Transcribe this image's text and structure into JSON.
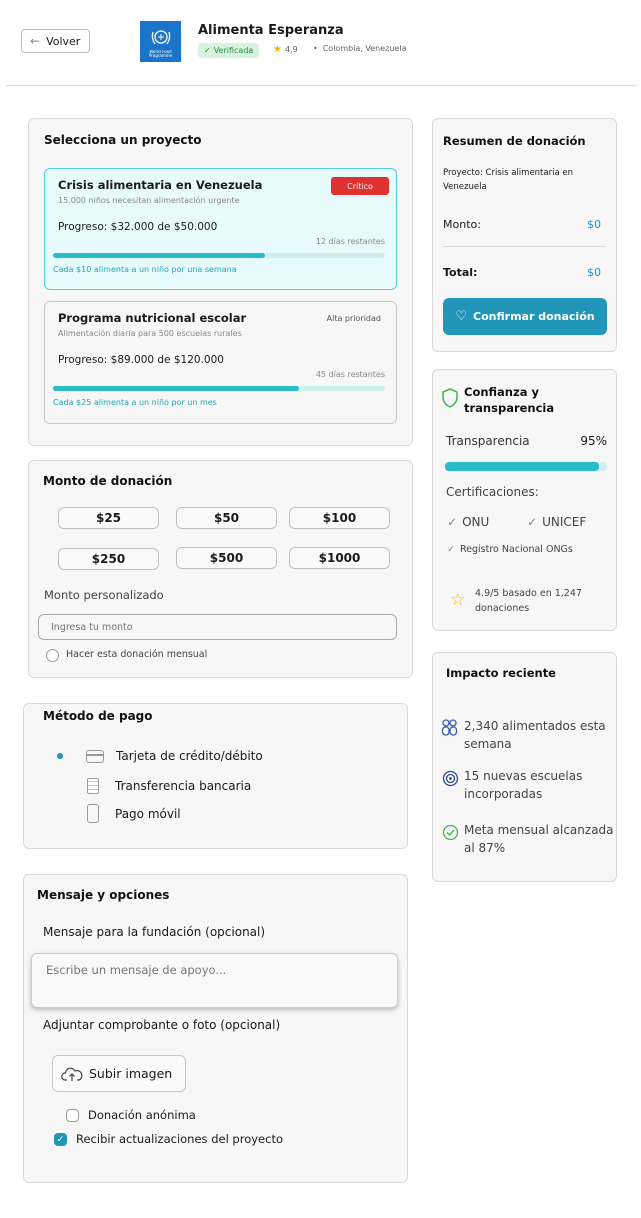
{
  "header": {
    "back_label": "Volver",
    "org_name": "Alimenta Esperanza",
    "verified_label": "Verificada",
    "rating": "4,9",
    "location": "Colombia, Venezuela",
    "logo_text": "World Food Programme"
  },
  "projects": {
    "title": "Selecciona un proyecto",
    "items": [
      {
        "name": "Crisis alimentaria en Venezuela",
        "subtitle": "15.000 niños necesitan alimentación urgente",
        "badge": "Crítico",
        "progress_label": "Progreso: $32.000 de $50.000",
        "progress": 0.64,
        "days_left": "12 días restantes",
        "impact_note": "Cada $10 alimenta a un niño por una semana"
      },
      {
        "name": "Programa nutricional escolar",
        "subtitle": "Alimentación diaria para 500 escuelas rurales",
        "badge": "Alta prioridad",
        "progress_label": "Progreso: $89.000 de $120.000",
        "progress": 0.74,
        "days_left": "45 días restantes",
        "impact_note": "Cada $25 alimenta a un niño por un mes"
      }
    ]
  },
  "amount": {
    "title": "Monto de donación",
    "presets": [
      "$25",
      "$50",
      "$100",
      "$250",
      "$500",
      "$1000"
    ],
    "custom_label": "Monto personalizado",
    "custom_placeholder": "Ingresa tu monto",
    "monthly_label": "Hacer esta donación mensual"
  },
  "payment": {
    "title": "Método de pago",
    "options": [
      "Tarjeta de crédito/débito",
      "Transferencia bancaria",
      "Pago móvil"
    ]
  },
  "message": {
    "title": "Mensaje y opciones",
    "message_label": "Mensaje para la fundación (opcional)",
    "message_placeholder": "Escribe un mensaje de apoyo...",
    "attach_label": "Adjuntar comprobante o foto (opcional)",
    "upload_label": "Subir imagen",
    "anonymous_label": "Donación anónima",
    "updates_label": "Recibir actualizaciones del proyecto"
  },
  "summary": {
    "title": "Resumen de donación",
    "project_line": "Proyecto: Crisis alimentaria en Venezuela",
    "amount_label": "Monto:",
    "amount_value": "$0",
    "total_label": "Total:",
    "total_value": "$0",
    "confirm_label": "Confirmar donación"
  },
  "trust": {
    "title": "Confianza y transparencia",
    "transparency_label": "Transparencia",
    "transparency_value": "95%",
    "transparency": 0.95,
    "cert_title": "Certificaciones:",
    "certs": [
      "ONU",
      "UNICEF",
      "Registro Nacional ONGs"
    ],
    "rating_text": "4.9/5 basado en 1,247 donaciones"
  },
  "impact": {
    "title": "Impacto reciente",
    "items": [
      "2,340 alimentados esta semana",
      "15 nuevas escuelas incorporadas",
      "Meta mensual alcanzada al 87%"
    ]
  },
  "colors": {
    "accent": "#2bbccb",
    "critical": "#e03131",
    "confirm": "#2196b8"
  }
}
